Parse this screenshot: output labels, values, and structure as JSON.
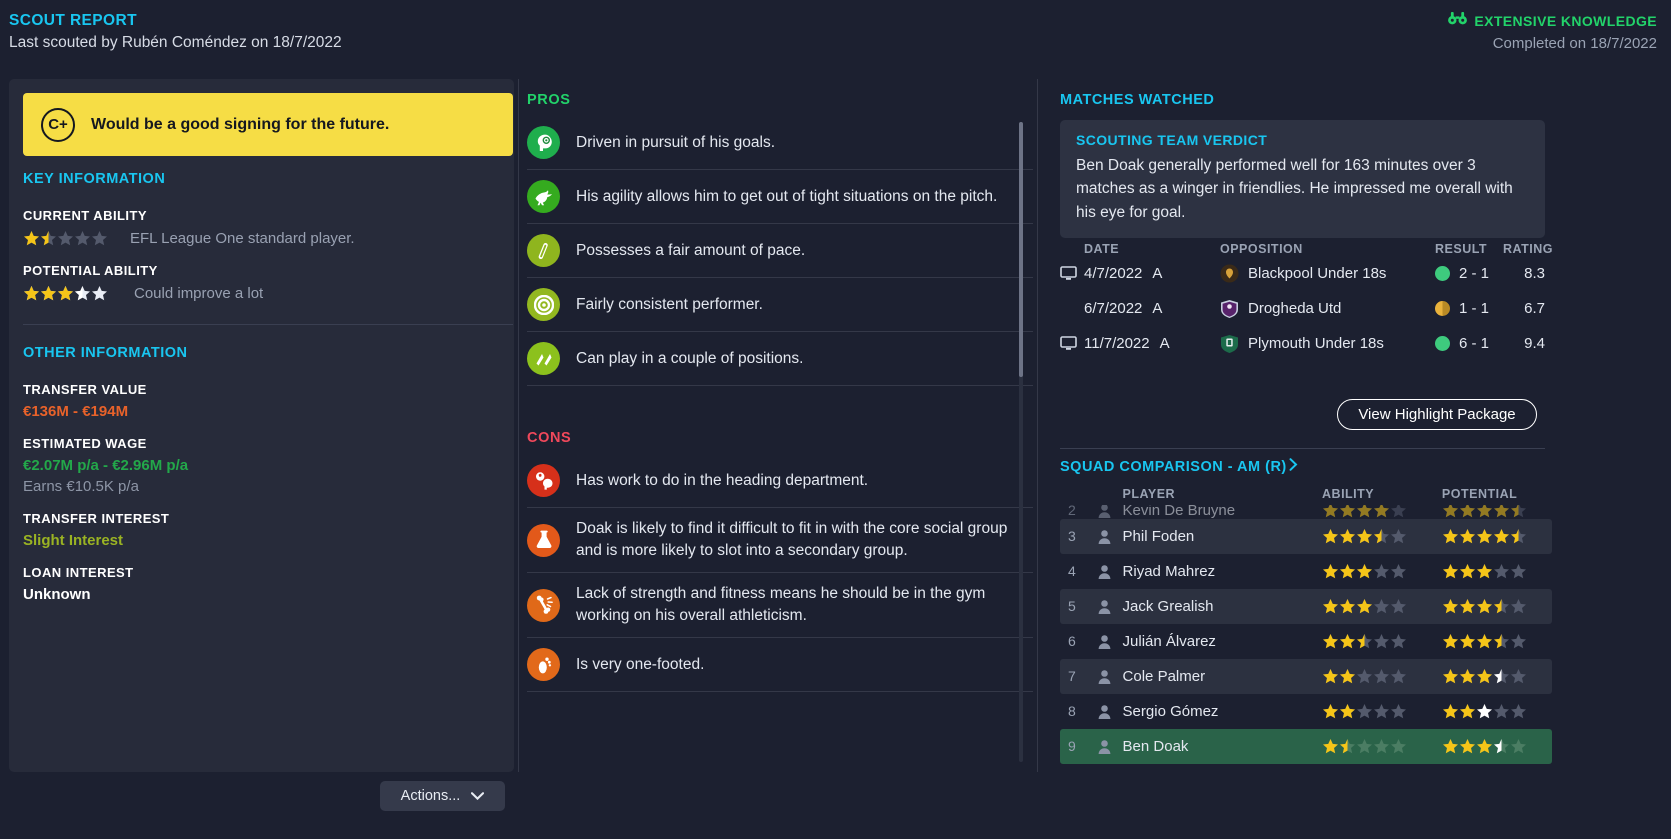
{
  "header": {
    "title": "SCOUT REPORT",
    "subtitle": "Last scouted by Rubén Coméndez on 18/7/2022",
    "knowledge_label": "EXTENSIVE KNOWLEDGE",
    "knowledge_icon": "binoculars-icon",
    "completed": "Completed on 18/7/2022",
    "knowledge_color": "#22d36a",
    "accent_color": "#19c6f0"
  },
  "verdict": {
    "grade": "C+",
    "text": "Would be a good signing for the future.",
    "background": "#f6dd45"
  },
  "key_information": {
    "heading": "KEY INFORMATION",
    "current_ability": {
      "label": "CURRENT ABILITY",
      "stars": 1.5,
      "max_stars": 5,
      "caption": "EFL League One standard player."
    },
    "potential_ability": {
      "label": "POTENTIAL ABILITY",
      "stars": 3.5,
      "max_stars": 5,
      "white_from": 3,
      "caption": "Could improve a lot"
    }
  },
  "other_information": {
    "heading": "OTHER INFORMATION",
    "transfer_value": {
      "label": "TRANSFER VALUE",
      "value": "€136M - €194M",
      "color": "#e8622a"
    },
    "estimated_wage": {
      "label": "ESTIMATED WAGE",
      "value": "€2.07M p/a - €2.96M p/a",
      "color": "#23a84a",
      "earns": "Earns €10.5K p/a"
    },
    "transfer_interest": {
      "label": "TRANSFER INTEREST",
      "value": "Slight Interest",
      "color": "#9ab323"
    },
    "loan_interest": {
      "label": "LOAN INTEREST",
      "value": "Unknown",
      "color": "#ffffff"
    }
  },
  "actions_button": {
    "label": "Actions...",
    "icon": "chevron-down-icon"
  },
  "pros": {
    "heading": "PROS",
    "items": [
      {
        "text": "Driven in pursuit of his goals.",
        "icon": "head-determination-icon",
        "color": "#1fae4d"
      },
      {
        "text": "His agility allows him to get out of tight situations on the pitch.",
        "icon": "agility-cheetah-icon",
        "color": "#35ab1f"
      },
      {
        "text": "Possesses a fair amount of pace.",
        "icon": "pace-leg-icon",
        "color": "#8fb51e"
      },
      {
        "text": "Fairly consistent performer.",
        "icon": "target-consistency-icon",
        "color": "#93b820"
      },
      {
        "text": "Can play in a couple of positions.",
        "icon": "versatility-arrows-icon",
        "color": "#8cc11d"
      }
    ]
  },
  "cons": {
    "heading": "CONS",
    "items": [
      {
        "text": "Has work to do in the heading department.",
        "icon": "heading-ball-icon",
        "color": "#d6301a"
      },
      {
        "text": "Doak is likely to find it difficult to fit in with the core social group and is more likely to slot into a secondary group.",
        "icon": "flask-personality-icon",
        "color": "#e2591a"
      },
      {
        "text": "Lack of strength and fitness means he should be in the gym working on his overall athleticism.",
        "icon": "injury-bone-icon",
        "color": "#e06919"
      },
      {
        "text": "Is very one-footed.",
        "icon": "foot-icon",
        "color": "#e2691a"
      }
    ]
  },
  "matches_watched": {
    "heading": "MATCHES WATCHED",
    "verdict_box": {
      "heading": "SCOUTING TEAM VERDICT",
      "text": "Ben Doak generally performed well for 163 minutes over 3 matches as a winger in friendlies. He impressed me overall with his eye for goal."
    },
    "columns": [
      "DATE",
      "OPPOSITION",
      "RESULT",
      "RATING"
    ],
    "rows": [
      {
        "watched": true,
        "date": "4/7/2022",
        "venue": "A",
        "opposition": "Blackpool Under 18s",
        "crest": "blackpool-crest-icon",
        "outcome": "win",
        "score": "2 - 1",
        "rating": "8.3"
      },
      {
        "watched": false,
        "date": "6/7/2022",
        "venue": "A",
        "opposition": "Drogheda Utd",
        "crest": "drogheda-crest-icon",
        "outcome": "draw",
        "score": "1 - 1",
        "rating": "6.7"
      },
      {
        "watched": true,
        "date": "11/7/2022",
        "venue": "A",
        "opposition": "Plymouth Under 18s",
        "crest": "plymouth-crest-icon",
        "outcome": "win",
        "score": "6 - 1",
        "rating": "9.4"
      }
    ],
    "highlight_button": "View Highlight Package"
  },
  "squad_comparison": {
    "heading": "SQUAD COMPARISON - AM (R)",
    "chevron": "chevron-right-icon",
    "columns": [
      "PLAYER",
      "ABILITY",
      "POTENTIAL"
    ],
    "rows": [
      {
        "rank": "2",
        "name": "Kevin De Bruyne",
        "ability": 4,
        "potential": 4.5,
        "clipped": true,
        "selected": false
      },
      {
        "rank": "3",
        "name": "Phil Foden",
        "ability": 3.5,
        "potential": 4.5,
        "clipped": false,
        "selected": false
      },
      {
        "rank": "4",
        "name": "Riyad Mahrez",
        "ability": 3,
        "potential": 3,
        "clipped": false,
        "selected": false
      },
      {
        "rank": "5",
        "name": "Jack Grealish",
        "ability": 3,
        "potential": 3.5,
        "clipped": false,
        "selected": false
      },
      {
        "rank": "6",
        "name": "Julián Álvarez",
        "ability": 2.5,
        "potential": 3.5,
        "clipped": false,
        "selected": false
      },
      {
        "rank": "7",
        "name": "Cole Palmer",
        "ability": 2,
        "potential": 3.5,
        "potential_white_from": 3,
        "clipped": false,
        "selected": false
      },
      {
        "rank": "8",
        "name": "Sergio Gómez",
        "ability": 2,
        "potential": 3,
        "potential_white_from": 2,
        "clipped": false,
        "selected": false
      },
      {
        "rank": "9",
        "name": "Ben Doak",
        "ability": 1.5,
        "potential": 3.5,
        "potential_white_from": 3,
        "clipped": false,
        "selected": true
      }
    ],
    "selected_row_color": "#2a6349"
  }
}
